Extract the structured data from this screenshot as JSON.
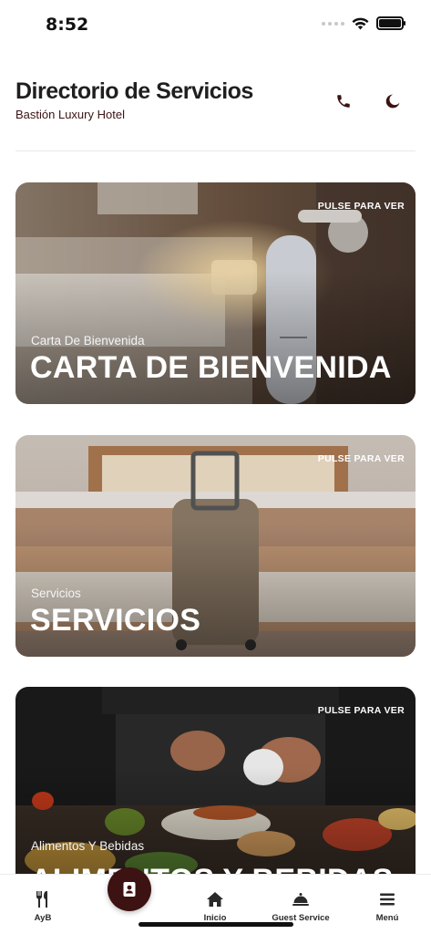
{
  "status_bar": {
    "time": "8:52"
  },
  "header": {
    "title": "Directorio de Servicios",
    "subtitle": "Bastión Luxury Hotel",
    "actions": [
      "phone-icon",
      "moon-icon"
    ]
  },
  "cards": [
    {
      "badge": "PULSE PARA VER",
      "subtitle": "Carta De Bienvenida",
      "title": "CARTA DE BIENVENIDA"
    },
    {
      "badge": "PULSE PARA VER",
      "subtitle": "Servicios",
      "title": "SERVICIOS"
    },
    {
      "badge": "PULSE PARA VER",
      "subtitle": "Alimentos Y Bebidas",
      "title": "ALIMENTOS Y BEBIDAS"
    }
  ],
  "bottom_nav": {
    "items": [
      {
        "label": "AyB",
        "icon": "fork-knife-icon"
      },
      {
        "label": "",
        "icon": "directory-icon"
      },
      {
        "label": "Inicio",
        "icon": "home-icon"
      },
      {
        "label": "Guest Service",
        "icon": "service-bell-icon"
      },
      {
        "label": "Menú",
        "icon": "menu-icon"
      }
    ]
  },
  "colors": {
    "accent": "#3d1212",
    "background": "#ffffff",
    "text": "#1f1f1f"
  }
}
